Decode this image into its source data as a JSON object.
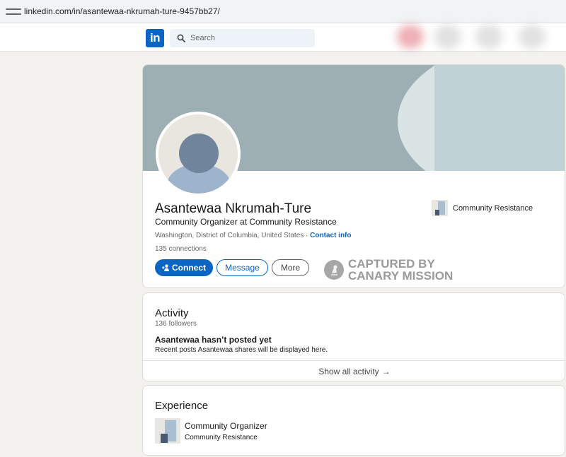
{
  "browser": {
    "url": "linkedin.com/in/asantewaa-nkrumah-ture-9457bb27/"
  },
  "nav": {
    "logo": "in",
    "search_placeholder": "Search"
  },
  "profile": {
    "name": "Asantewaa Nkrumah-Ture",
    "headline": "Community Organizer at Community Resistance",
    "location": "Washington, District of Columbia, United States",
    "location_sep": " · ",
    "contact_info": "Contact info",
    "connections": "135 connections",
    "current_company": "Community Resistance",
    "buttons": {
      "connect": "Connect",
      "message": "Message",
      "more": "More"
    }
  },
  "watermark": {
    "line1": "CAPTURED BY",
    "line2": "CANARY MISSION"
  },
  "activity": {
    "title": "Activity",
    "followers": "136 followers",
    "empty_title": "Asantewaa hasn’t posted yet",
    "empty_sub": "Recent posts Asantewaa shares will be displayed here.",
    "show_all": "Show all activity",
    "show_all_arrow": "→"
  },
  "experience": {
    "title": "Experience",
    "items": [
      {
        "role": "Community Organizer",
        "company": "Community Resistance"
      }
    ]
  },
  "colors": {
    "brand": "#0a66c2",
    "background": "#f3f2ef",
    "banner": "#9eafb3"
  }
}
